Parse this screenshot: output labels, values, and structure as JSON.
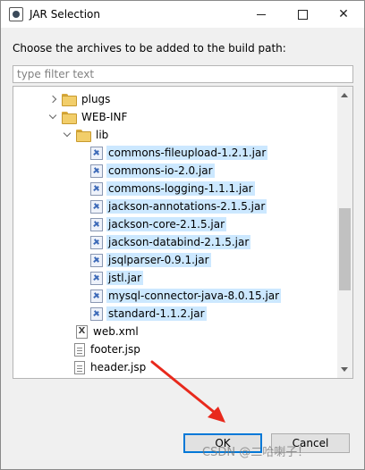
{
  "window": {
    "title": "JAR Selection",
    "close_glyph": "✕"
  },
  "prompt": "Choose the archives to be added to the build path:",
  "filter": {
    "placeholder": "type filter text",
    "value": ""
  },
  "tree": [
    {
      "label": "plugs",
      "type": "folder",
      "expanded": false,
      "level": 2,
      "selected": false
    },
    {
      "label": "WEB-INF",
      "type": "folder",
      "expanded": true,
      "level": 2,
      "selected": false
    },
    {
      "label": "lib",
      "type": "folder",
      "expanded": true,
      "level": 3,
      "selected": false
    },
    {
      "label": "commons-fileupload-1.2.1.jar",
      "type": "jar",
      "level": 4,
      "selected": true
    },
    {
      "label": "commons-io-2.0.jar",
      "type": "jar",
      "level": 4,
      "selected": true
    },
    {
      "label": "commons-logging-1.1.1.jar",
      "type": "jar",
      "level": 4,
      "selected": true
    },
    {
      "label": "jackson-annotations-2.1.5.jar",
      "type": "jar",
      "level": 4,
      "selected": true
    },
    {
      "label": "jackson-core-2.1.5.jar",
      "type": "jar",
      "level": 4,
      "selected": true
    },
    {
      "label": "jackson-databind-2.1.5.jar",
      "type": "jar",
      "level": 4,
      "selected": true
    },
    {
      "label": "jsqlparser-0.9.1.jar",
      "type": "jar",
      "level": 4,
      "selected": true
    },
    {
      "label": "jstl.jar",
      "type": "jar",
      "level": 4,
      "selected": true
    },
    {
      "label": "mysql-connector-java-8.0.15.jar",
      "type": "jar",
      "level": 4,
      "selected": true
    },
    {
      "label": "standard-1.1.2.jar",
      "type": "jar",
      "level": 4,
      "selected": true
    },
    {
      "label": "web.xml",
      "type": "xml",
      "level": 3,
      "selected": false
    },
    {
      "label": "footer.jsp",
      "type": "file",
      "level": 1,
      "selected": false
    },
    {
      "label": "header.jsp",
      "type": "file",
      "level": 1,
      "selected": false
    }
  ],
  "buttons": {
    "ok": "OK",
    "cancel": "Cancel"
  },
  "watermark": "CSDN @二哈喇子！",
  "colors": {
    "selection": "#cce8ff",
    "default_button_border": "#0078d7",
    "annotation_arrow": "#e8291c"
  }
}
